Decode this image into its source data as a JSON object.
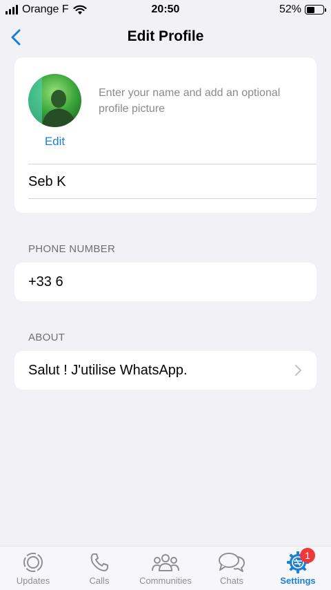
{
  "status_bar": {
    "carrier": "Orange F",
    "time": "20:50",
    "battery_percent": "52%",
    "battery_level": 0.52
  },
  "nav": {
    "title": "Edit Profile",
    "back_icon": "chevron-left-icon"
  },
  "profile": {
    "edit_label": "Edit",
    "hint": "Enter your name and add an optional profile picture",
    "name_value": "Seb K"
  },
  "phone": {
    "header": "PHONE NUMBER",
    "value": "+33 6"
  },
  "about": {
    "header": "ABOUT",
    "value": "Salut ! J'utilise WhatsApp."
  },
  "tabs": [
    {
      "label": "Updates",
      "icon": "updates-icon",
      "active": false
    },
    {
      "label": "Calls",
      "icon": "phone-icon",
      "active": false
    },
    {
      "label": "Communities",
      "icon": "communities-icon",
      "active": false
    },
    {
      "label": "Chats",
      "icon": "chats-icon",
      "active": false
    },
    {
      "label": "Settings",
      "icon": "gear-icon",
      "active": true,
      "badge": "1"
    }
  ],
  "colors": {
    "accent": "#1a7fd4",
    "badge": "#f0383a",
    "background": "#f1f1f6"
  }
}
